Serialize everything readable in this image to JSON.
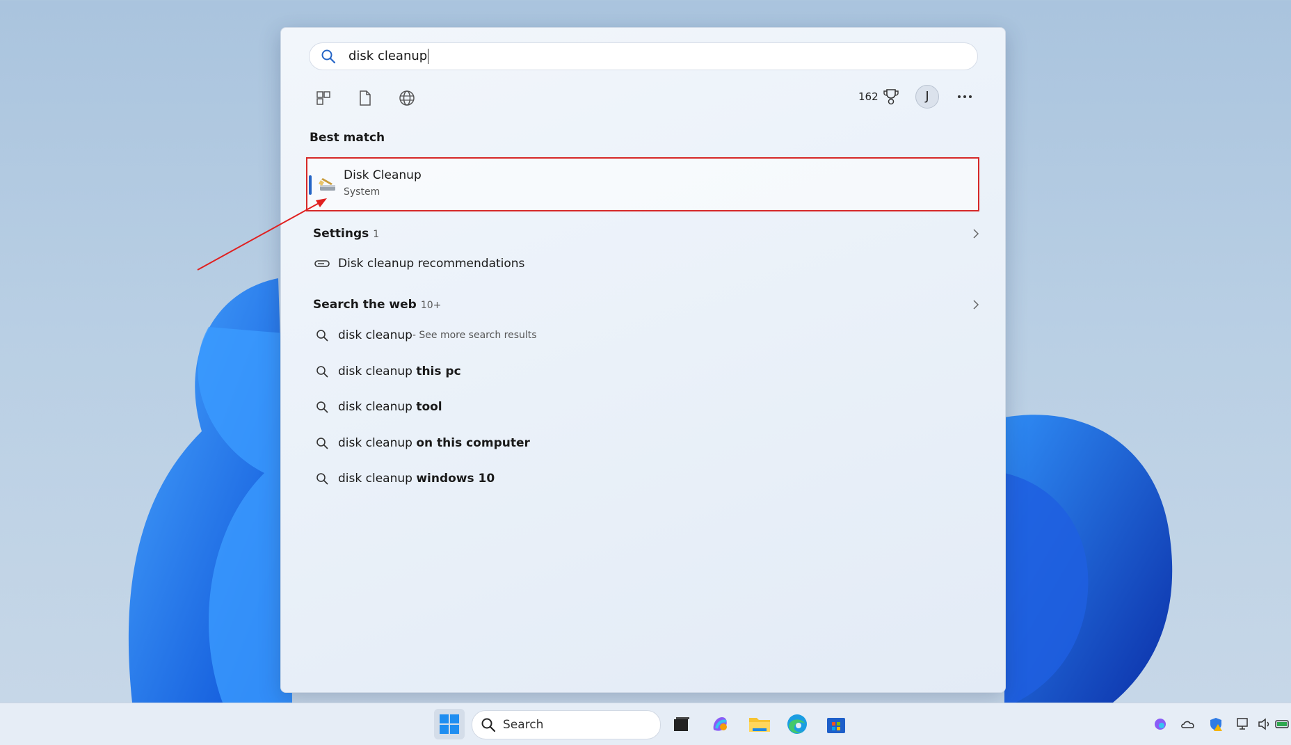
{
  "search": {
    "query": "disk cleanup"
  },
  "toolbar": {
    "points": "162",
    "avatar_letter": "J"
  },
  "best_match": {
    "heading": "Best match",
    "app_name": "Disk Cleanup",
    "app_sub": "System"
  },
  "settings": {
    "heading": "Settings",
    "count": "1",
    "items": [
      {
        "label": "Disk cleanup recommendations"
      }
    ]
  },
  "web": {
    "heading": "Search the web",
    "count": "10+",
    "items": [
      {
        "normal": "disk cleanup",
        "bold": "",
        "hint": " - See more search results"
      },
      {
        "normal": "disk cleanup ",
        "bold": "this pc",
        "hint": ""
      },
      {
        "normal": "disk cleanup ",
        "bold": "tool",
        "hint": ""
      },
      {
        "normal": "disk cleanup ",
        "bold": "on this computer",
        "hint": ""
      },
      {
        "normal": "disk cleanup ",
        "bold": "windows 10",
        "hint": ""
      }
    ]
  },
  "taskbar": {
    "search_label": "Search"
  },
  "colors": {
    "highlight_border": "#d62828",
    "accent": "#2565c6",
    "annotation_arrow": "#e02020"
  }
}
